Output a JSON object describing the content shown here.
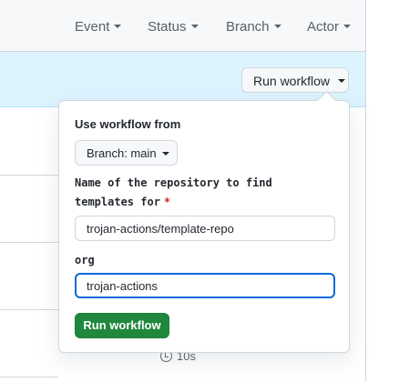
{
  "filters": [
    "Event",
    "Status",
    "Branch",
    "Actor"
  ],
  "banner": {
    "run_workflow_label": "Run workflow"
  },
  "dropdown": {
    "use_workflow_from_label": "Use workflow from",
    "branch_button_label": "Branch: main",
    "repo_input_label": "Name of the repository to find templates for",
    "required_marker": "*",
    "repo_input_value": "trojan-actions/template-repo",
    "org_label": "org",
    "org_input_value": "trojan-actions",
    "submit_label": "Run workflow"
  },
  "background_row": {
    "duration": "10s"
  },
  "icons": {
    "filter_caret": "caret-down-icon",
    "timer": "stopwatch-icon"
  },
  "colors": {
    "primary_button": "#1f883d",
    "focus_border": "#0969da",
    "required": "#cf222e",
    "banner_bg": "#ddf4ff"
  }
}
